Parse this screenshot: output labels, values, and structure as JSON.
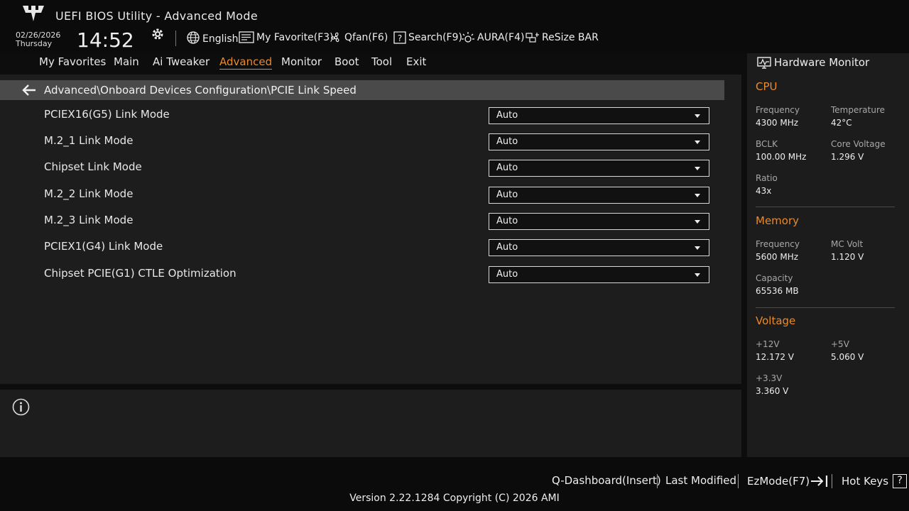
{
  "header": {
    "title": "UEFI BIOS Utility - Advanced Mode",
    "date": "02/26/2026",
    "day": "Thursday",
    "time": "14:52",
    "toolbar": [
      {
        "label": "English",
        "icon": "globe-icon"
      },
      {
        "label": "My Favorite(F3)",
        "icon": "favorite-list-icon"
      },
      {
        "label": "Qfan(F6)",
        "icon": "fan-icon"
      },
      {
        "label": "Search(F9)",
        "icon": "search-help-icon"
      },
      {
        "label": "AURA(F4)",
        "icon": "aura-light-icon"
      },
      {
        "label": "ReSize BAR",
        "icon": "resize-bar-icon"
      }
    ]
  },
  "tabs": [
    {
      "label": "My Favorites"
    },
    {
      "label": "Main"
    },
    {
      "label": "Ai Tweaker"
    },
    {
      "label": "Advanced",
      "active": true
    },
    {
      "label": "Monitor"
    },
    {
      "label": "Boot"
    },
    {
      "label": "Tool"
    },
    {
      "label": "Exit"
    }
  ],
  "breadcrumb": "Advanced\\Onboard Devices Configuration\\PCIE Link Speed",
  "settings": [
    {
      "label": "PCIEX16(G5) Link Mode",
      "value": "Auto"
    },
    {
      "label": "M.2_1 Link Mode",
      "value": "Auto"
    },
    {
      "label": "Chipset Link Mode",
      "value": "Auto"
    },
    {
      "label": "M.2_2 Link Mode",
      "value": "Auto"
    },
    {
      "label": "M.2_3 Link Mode",
      "value": "Auto"
    },
    {
      "label": "PCIEX1(G4) Link Mode",
      "value": "Auto"
    },
    {
      "label": "Chipset PCIE(G1) CTLE Optimization",
      "value": "Auto"
    }
  ],
  "hardware_monitor": {
    "title": "Hardware Monitor",
    "cpu": {
      "heading": "CPU",
      "frequency_label": "Frequency",
      "frequency": "4300 MHz",
      "temperature_label": "Temperature",
      "temperature": "42°C",
      "bclk_label": "BCLK",
      "bclk": "100.00 MHz",
      "core_voltage_label": "Core Voltage",
      "core_voltage": "1.296 V",
      "ratio_label": "Ratio",
      "ratio": "43x"
    },
    "memory": {
      "heading": "Memory",
      "frequency_label": "Frequency",
      "frequency": "5600 MHz",
      "mc_volt_label": "MC Volt",
      "mc_volt": "1.120 V",
      "capacity_label": "Capacity",
      "capacity": "65536 MB"
    },
    "voltage": {
      "heading": "Voltage",
      "v12_label": "+12V",
      "v12": "12.172 V",
      "v5_label": "+5V",
      "v5": "5.060 V",
      "v33_label": "+3.3V",
      "v33": "3.360 V"
    }
  },
  "footer": {
    "q_dashboard": "Q-Dashboard(Insert)",
    "last_modified": "Last Modified",
    "ezmode": "EzMode(F7)",
    "hot_keys": "Hot Keys",
    "hot_keys_glyph": "?",
    "version": "Version 2.22.1284 Copyright (C) 2026 AMI"
  },
  "colors": {
    "accent": "#e88a2e",
    "background": "#1b1b1b",
    "bar": "#0b0b0b"
  }
}
